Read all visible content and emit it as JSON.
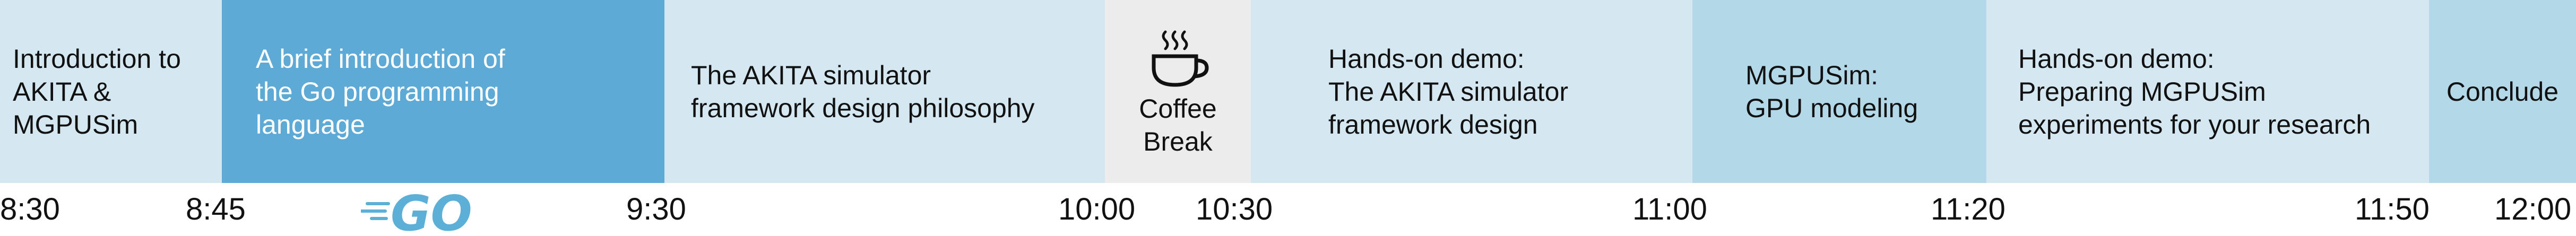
{
  "segments": [
    {
      "label": "Introduction to\nAKITA &\nMGPUSim"
    },
    {
      "label": "A brief introduction of\nthe Go programming\nlanguage"
    },
    {
      "label": "The AKITA simulator\nframework design philosophy"
    },
    {
      "label": "Coffee\nBreak"
    },
    {
      "label": "Hands-on demo:\nThe AKITA simulator\nframework design"
    },
    {
      "label": "MGPUSim:\nGPU modeling"
    },
    {
      "label": "Hands-on demo:\nPreparing MGPUSim\nexperiments for your research"
    },
    {
      "label": "Conclude"
    }
  ],
  "times": [
    "8:30",
    "8:45",
    "9:30",
    "10:00",
    "10:30",
    "11:00",
    "11:20",
    "11:50",
    "12:00"
  ],
  "logo": {
    "text": "GO",
    "color": "#5cb0d8"
  },
  "colors": {
    "light_blue": "#d5e8f2",
    "mid_blue": "#b3d8e8",
    "dark_blue": "#5eaad6",
    "gray": "#ececec"
  },
  "icons": {
    "gopher": "gopher-mascot-icon",
    "coffee": "coffee-cup-icon"
  }
}
